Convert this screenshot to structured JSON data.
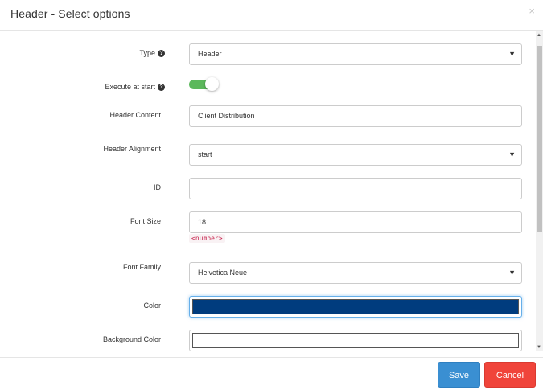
{
  "dialog": {
    "title": "Header - Select options",
    "close_icon": "×"
  },
  "form": {
    "type": {
      "label": "Type",
      "value": "Header"
    },
    "execute_at_start": {
      "label": "Execute at start",
      "enabled": true
    },
    "header_content": {
      "label": "Header Content",
      "value": "Client Distribution"
    },
    "header_alignment": {
      "label": "Header Alignment",
      "value": "start"
    },
    "id": {
      "label": "ID",
      "value": ""
    },
    "font_size": {
      "label": "Font Size",
      "value": "18",
      "hint": "<number>"
    },
    "font_family": {
      "label": "Font Family",
      "value": "Helvetica Neue"
    },
    "color": {
      "label": "Color",
      "value": "#003c7e"
    },
    "background_color": {
      "label": "Background Color",
      "value": "#ffffff"
    }
  },
  "icons": {
    "help": "?",
    "select_arrow": "▼",
    "scroll_up": "▲",
    "scroll_down": "▼"
  },
  "footer": {
    "save_label": "Save",
    "cancel_label": "Cancel",
    "save_color": "#3a8fd2",
    "cancel_color": "#f0443a"
  }
}
